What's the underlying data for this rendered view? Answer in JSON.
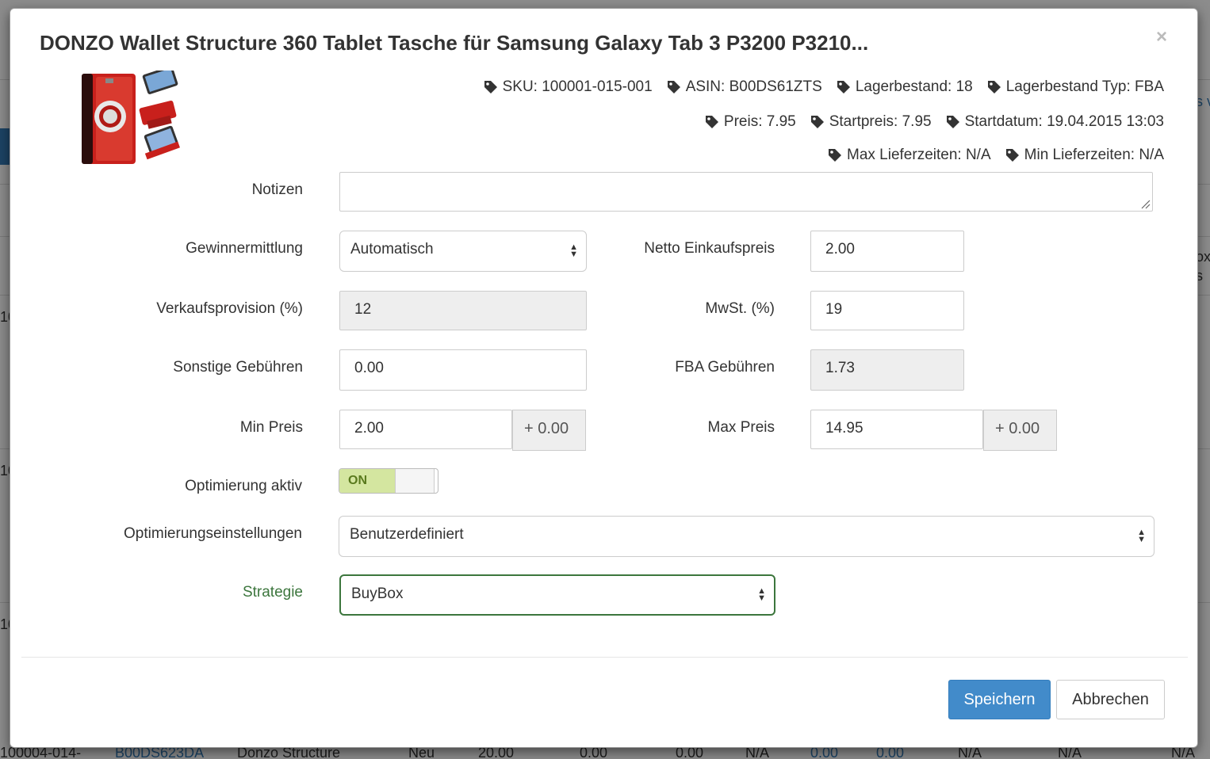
{
  "modal": {
    "title": "DONZO Wallet Structure 360 Tablet Tasche für Samsung Galaxy Tab 3 P3200 P3210...",
    "close": "×"
  },
  "meta": {
    "row1": [
      "SKU: 100001-015-001",
      "ASIN: B00DS61ZTS",
      "Lagerbestand: 18",
      "Lagerbestand Typ: FBA"
    ],
    "row2": [
      "Preis: 7.95",
      "Startpreis: 7.95",
      "Startdatum: 19.04.2015 13:03"
    ],
    "row3": [
      "Max Lieferzeiten: N/A",
      "Min Lieferzeiten: N/A"
    ]
  },
  "form": {
    "notizen_label": "Notizen",
    "notizen_value": "",
    "gewinn_label": "Gewinnermittlung",
    "gewinn_value": "Automatisch",
    "netto_label": "Netto Einkaufspreis",
    "netto_value": "2.00",
    "provision_label": "Verkaufsprovision (%)",
    "provision_value": "12",
    "mwst_label": "MwSt. (%)",
    "mwst_value": "19",
    "sonstige_label": "Sonstige Gebühren",
    "sonstige_value": "0.00",
    "fba_label": "FBA Gebühren",
    "fba_value": "1.73",
    "minpreis_label": "Min Preis",
    "minpreis_value": "2.00",
    "minpreis_addon": "+ 0.00",
    "maxpreis_label": "Max Preis",
    "maxpreis_value": "14.95",
    "maxpreis_addon": "+ 0.00",
    "optimierung_label": "Optimierung aktiv",
    "optimierung_state": "ON",
    "einstellungen_label": "Optimierungseinstellungen",
    "einstellungen_value": "Benutzerdefiniert",
    "strategie_label": "Strategie",
    "strategie_value": "BuyBox"
  },
  "footer": {
    "save": "Speichern",
    "cancel": "Abbrechen"
  },
  "background": {
    "row_start": "100004-014-",
    "row_asin": "B00DS623DA",
    "row_name": "Donzo Structure",
    "row_cond": "Neu",
    "row_price": "20.00",
    "cells": [
      "0.00",
      "0.00",
      "N/A",
      "0.00",
      "0.00",
      "N/A",
      "N/A",
      "N/A"
    ],
    "side_10a": "10",
    "side_10b": "10",
    "side_10c": "10",
    "right_sv": "s v",
    "right_ox": "ox",
    "right_s": "s"
  },
  "colors": {
    "primary": "#428bca",
    "success_text": "#3c763d",
    "toggle_on": "#d4e6a0"
  }
}
